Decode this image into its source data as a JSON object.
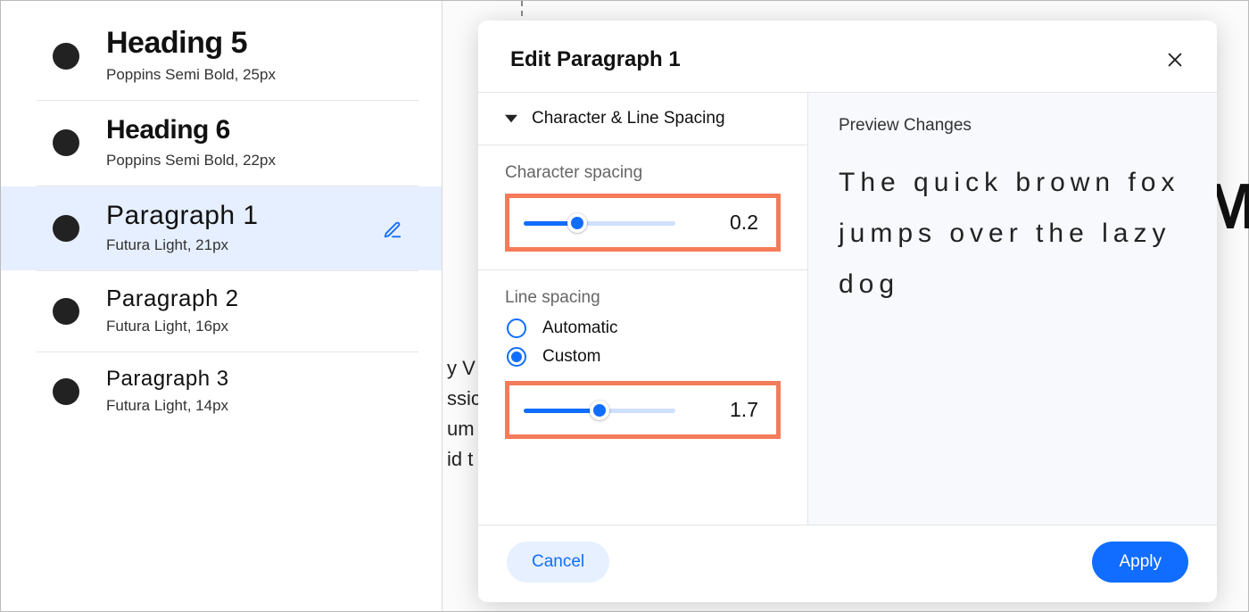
{
  "styles": [
    {
      "name": "Heading 5",
      "desc": "Poppins Semi Bold, 25px",
      "cls": "h5",
      "selected": false
    },
    {
      "name": "Heading 6",
      "desc": "Poppins Semi Bold, 22px",
      "cls": "h6",
      "selected": false
    },
    {
      "name": "Paragraph 1",
      "desc": "Futura Light, 21px",
      "cls": "p1",
      "selected": true
    },
    {
      "name": "Paragraph 2",
      "desc": "Futura Light, 16px",
      "cls": "p2",
      "selected": false
    },
    {
      "name": "Paragraph 3",
      "desc": "Futura Light, 14px",
      "cls": "p3",
      "selected": false
    }
  ],
  "modal": {
    "title": "Edit Paragraph 1",
    "accordion_label": "Character & Line Spacing",
    "char_spacing": {
      "label": "Character spacing",
      "value": "0.2",
      "fill_pct": 35
    },
    "line_spacing": {
      "label": "Line spacing",
      "radios": {
        "auto": "Automatic",
        "custom": "Custom"
      },
      "selected": "custom",
      "value": "1.7",
      "fill_pct": 50
    },
    "preview_heading": "Preview Changes",
    "preview_text": "The quick brown fox jumps over the lazy dog",
    "cancel_label": "Cancel",
    "apply_label": "Apply"
  },
  "canvas_hint_lines": "y V\nssic\num\nid t",
  "canvas_hint_m": "M"
}
